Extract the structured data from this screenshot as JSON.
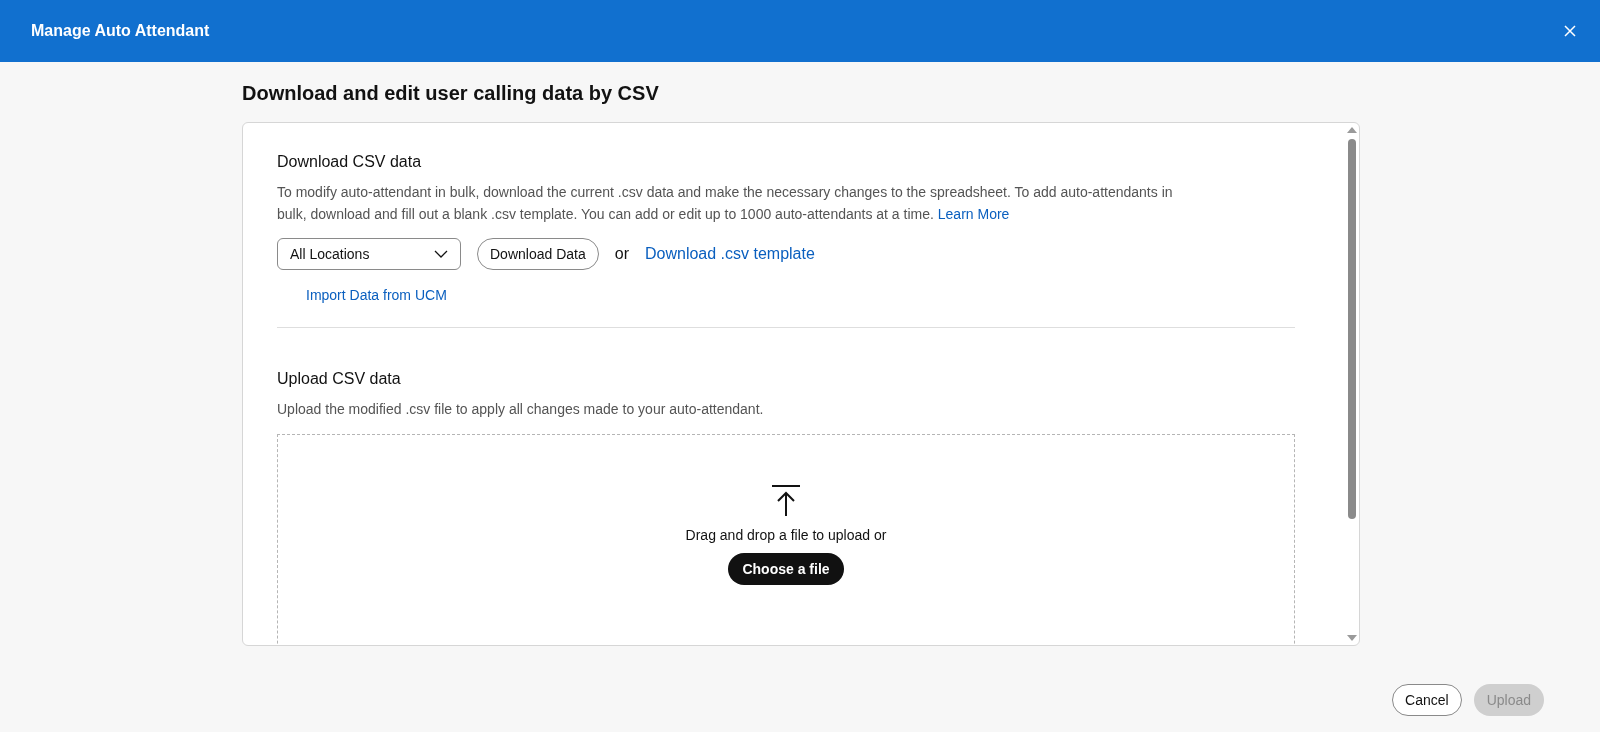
{
  "window": {
    "title": "Manage Auto Attendant"
  },
  "page_title": "Download and edit user calling data by CSV",
  "download": {
    "heading": "Download CSV data",
    "text": "To modify auto-attendant in bulk, download the current .csv data and make the necessary changes to the spreadsheet. To add auto-attendants in bulk, download and fill out a blank .csv template. You can add or edit up to 1000 auto-attendants at a time.",
    "learn_more": "Learn More",
    "location_select": {
      "value": "All Locations"
    },
    "download_button": "Download Data",
    "or_text": "or",
    "template_link": "Download .csv template",
    "import_link": "Import Data from UCM"
  },
  "upload": {
    "heading": "Upload CSV data",
    "text": "Upload the modified .csv file to apply all changes made to your auto-attendant.",
    "drop_text": "Drag and drop a file to upload or",
    "choose_button": "Choose a file"
  },
  "footer": {
    "buttons": [
      {
        "label": "Cancel",
        "kind": "secondary",
        "disabled": false
      },
      {
        "label": "Upload",
        "kind": "primary",
        "disabled": true
      }
    ]
  }
}
